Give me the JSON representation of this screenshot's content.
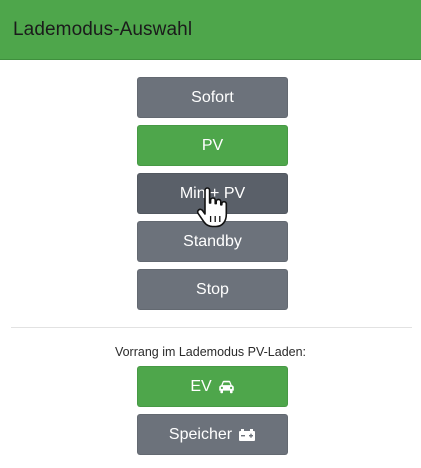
{
  "header": {
    "title": "Lademodus-Auswahl"
  },
  "modes": {
    "sofort": "Sofort",
    "pv": "PV",
    "min_pv": "Min + PV",
    "standby": "Standby",
    "stop": "Stop"
  },
  "priority": {
    "label": "Vorrang im Lademodus PV-Laden:",
    "ev": "EV",
    "speicher": "Speicher"
  },
  "icons": {
    "ev": "car-icon",
    "speicher": "battery-icon",
    "cursor": "hand-pointer-icon"
  },
  "colors": {
    "header_bg": "#4ea64b",
    "active": "#4ea64b",
    "inactive": "#6c727b",
    "hover": "#5a6069"
  },
  "state": {
    "active_mode": "PV",
    "active_priority": "EV",
    "hovered_mode": "Min + PV"
  }
}
